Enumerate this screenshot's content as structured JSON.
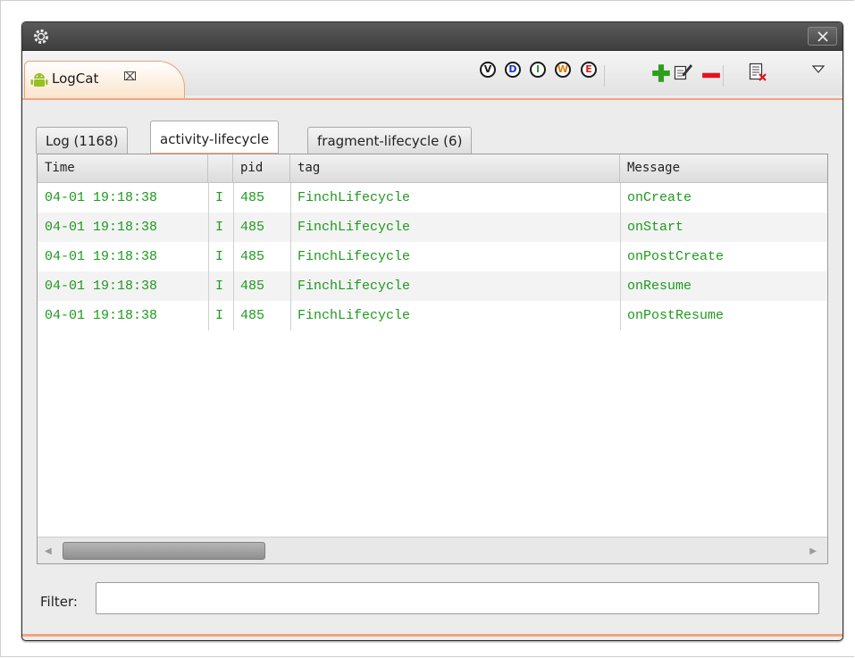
{
  "view": {
    "tab_label": "LogCat",
    "tab_close_glyph": "⌧"
  },
  "toolbar": {
    "levels": [
      {
        "letter": "V",
        "color": "#1a1a1a",
        "name": "verbose"
      },
      {
        "letter": "D",
        "color": "#1b2fd1",
        "name": "debug"
      },
      {
        "letter": "I",
        "color": "#2a9a2a",
        "name": "info"
      },
      {
        "letter": "W",
        "color": "#e07b00",
        "name": "warn"
      },
      {
        "letter": "E",
        "color": "#d61a1a",
        "name": "error"
      }
    ],
    "icons": [
      "add-filter-icon",
      "edit-filter-icon",
      "remove-filter-icon",
      "clear-log-icon",
      "view-menu-icon"
    ]
  },
  "subtabs": [
    {
      "label": "Log (1168)",
      "active": false
    },
    {
      "label": "activity-lifecycle",
      "active": true
    },
    {
      "label": "fragment-lifecycle (6)",
      "active": false
    }
  ],
  "table": {
    "headers": [
      "Time",
      "",
      "pid",
      "tag",
      "Message"
    ],
    "rows": [
      [
        "04-01 19:18:38",
        "I",
        "485",
        "FinchLifecycle",
        "onCreate"
      ],
      [
        "04-01 19:18:38",
        "I",
        "485",
        "FinchLifecycle",
        "onStart"
      ],
      [
        "04-01 19:18:38",
        "I",
        "485",
        "FinchLifecycle",
        "onPostCreate"
      ],
      [
        "04-01 19:18:38",
        "I",
        "485",
        "FinchLifecycle",
        "onResume"
      ],
      [
        "04-01 19:18:38",
        "I",
        "485",
        "FinchLifecycle",
        "onPostResume"
      ]
    ],
    "row_text_color": "#1e9a1e"
  },
  "filter": {
    "label": "Filter:",
    "value": ""
  },
  "colors": {
    "accent": "#f0a57e",
    "titlebar": "#4a4a4a"
  }
}
